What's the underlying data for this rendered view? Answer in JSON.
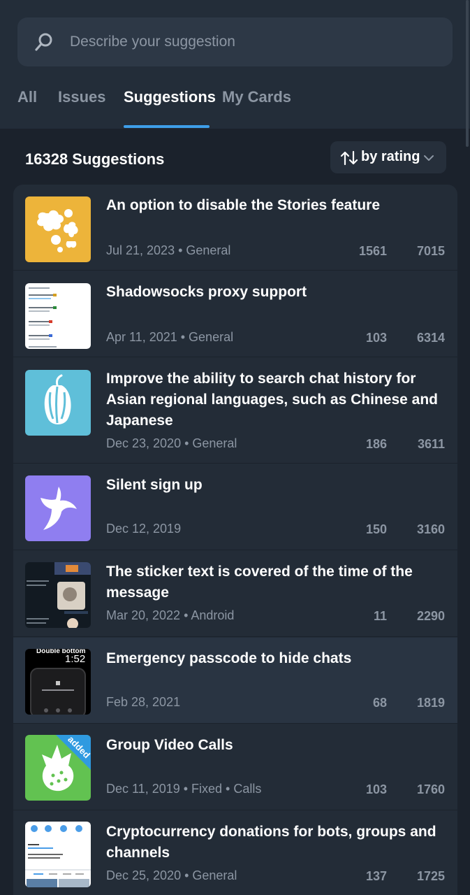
{
  "search": {
    "placeholder": "Describe your suggestion"
  },
  "tabs": [
    "All",
    "Issues",
    "Suggestions",
    "My Cards"
  ],
  "active_tab": "Suggestions",
  "summary": {
    "count_label": "16328 Suggestions",
    "sort_label": "by rating"
  },
  "accent": "#3e9ee9",
  "cards": [
    {
      "title": "An option to disable the Stories feature",
      "meta": "Jul 21, 2023 • General",
      "comments": "1561",
      "votes": "7015",
      "thumb": "bird-icon",
      "thumb_color": "#edb43a"
    },
    {
      "title": "Shadowsocks proxy support",
      "meta": "Apr 11, 2021 • General",
      "comments": "103",
      "votes": "6314",
      "thumb": "screenshot-connections",
      "thumb_color": "#ffffff"
    },
    {
      "title": "Improve the ability to search chat history for Asian regional languages, such as Chinese and Japanese",
      "meta": "Dec 23, 2020 • General",
      "comments": "186",
      "votes": "3611",
      "thumb": "cacao-icon",
      "thumb_color": "#5fbfd9"
    },
    {
      "title": "Silent sign up",
      "meta": "Dec 12, 2019",
      "comments": "150",
      "votes": "3160",
      "thumb": "banana-icon",
      "thumb_color": "#8f7ef0"
    },
    {
      "title": "The sticker text is covered of the time of the message",
      "meta": "Mar 20, 2022 • Android",
      "comments": "11",
      "votes": "2290",
      "thumb": "screenshot-chat",
      "thumb_color": "#121a22"
    },
    {
      "title": "Emergency passcode to hide chats",
      "meta": "Feb 28, 2021",
      "comments": "68",
      "votes": "1819",
      "thumb": "screenshot-phone",
      "thumb_color": "#000000",
      "thumb_text_top": "Double bottom",
      "thumb_text_time": "1:52"
    },
    {
      "title": "Group Video Calls",
      "meta": "Dec 11, 2019 • Fixed • Calls",
      "comments": "103",
      "votes": "1760",
      "thumb": "dragonfruit-icon",
      "thumb_color": "#62c251",
      "badge": "added"
    },
    {
      "title": "Cryptocurrency donations for bots, groups and channels",
      "meta": "Dec 25, 2020 • General",
      "comments": "137",
      "votes": "1725",
      "thumb": "screenshot-profile",
      "thumb_color": "#ffffff"
    }
  ]
}
